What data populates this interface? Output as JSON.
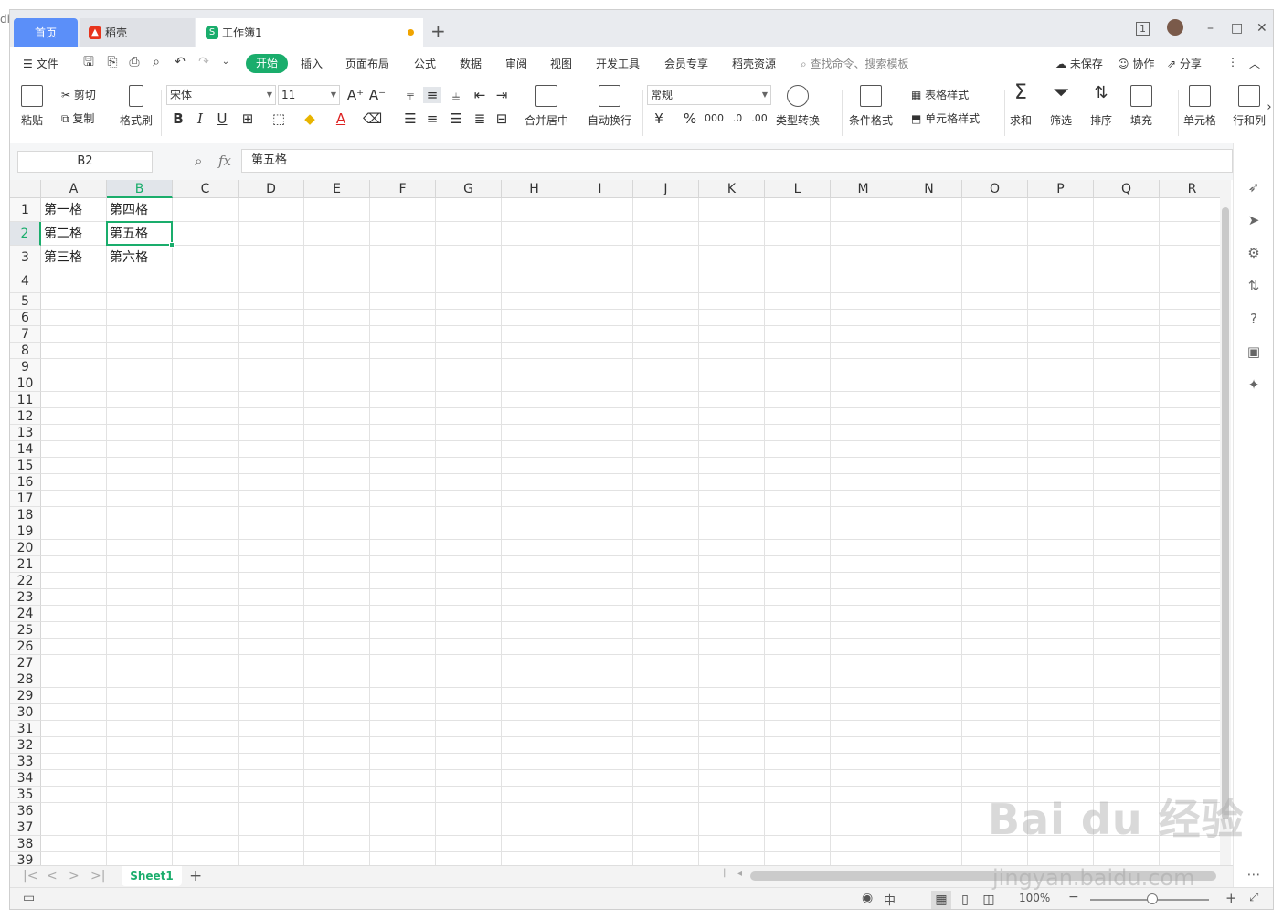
{
  "tabs": {
    "home": "首页",
    "daoke": "稻壳",
    "workbook": "工作簿1"
  },
  "menu": {
    "file": "文件",
    "items": [
      "开始",
      "插入",
      "页面布局",
      "公式",
      "数据",
      "审阅",
      "视图",
      "开发工具",
      "会员专享",
      "稻壳资源"
    ],
    "search_placeholder": "查找命令、搜索模板",
    "unsaved": "未保存",
    "collab": "协作",
    "share": "分享"
  },
  "ribbon": {
    "paste": "粘贴",
    "cut": "剪切",
    "copy": "复制",
    "format_painter": "格式刷",
    "font_name": "宋体",
    "font_size": "11",
    "merge_center": "合并居中",
    "wrap_text": "自动换行",
    "number_format": "常规",
    "type_convert": "类型转换",
    "cond_format": "条件格式",
    "table_style": "表格样式",
    "cell_style": "单元格样式",
    "sum": "求和",
    "filter": "筛选",
    "sort": "排序",
    "fill": "填充",
    "cell": "单元格",
    "row_col": "行和列"
  },
  "formula_bar": {
    "name_box": "B2",
    "fx": "fx",
    "content": "第五格"
  },
  "columns": [
    "A",
    "B",
    "C",
    "D",
    "E",
    "F",
    "G",
    "H",
    "I",
    "J",
    "K",
    "L",
    "M",
    "N",
    "O",
    "P",
    "Q",
    "R"
  ],
  "rows": [
    "1",
    "2",
    "3",
    "4",
    "5",
    "6",
    "7",
    "8",
    "9",
    "10",
    "11",
    "12",
    "13",
    "14",
    "15",
    "16",
    "17",
    "18",
    "19",
    "20",
    "21",
    "22",
    "23",
    "24",
    "25",
    "26",
    "27",
    "28",
    "29",
    "30",
    "31",
    "32",
    "33",
    "34",
    "35",
    "36",
    "37",
    "38",
    "39"
  ],
  "cells": {
    "A1": "第一格",
    "B1": "第四格",
    "A2": "第二格",
    "B2": "第五格",
    "A3": "第三格",
    "B3": "第六格"
  },
  "sheet": {
    "name": "Sheet1"
  },
  "status": {
    "zoom": "100%"
  },
  "watermark": {
    "main": "Bai du 经验",
    "sub": "jingyan.baidu.com"
  },
  "colors": {
    "accent": "#1aad6c",
    "home_tab": "#5b8ff9"
  }
}
